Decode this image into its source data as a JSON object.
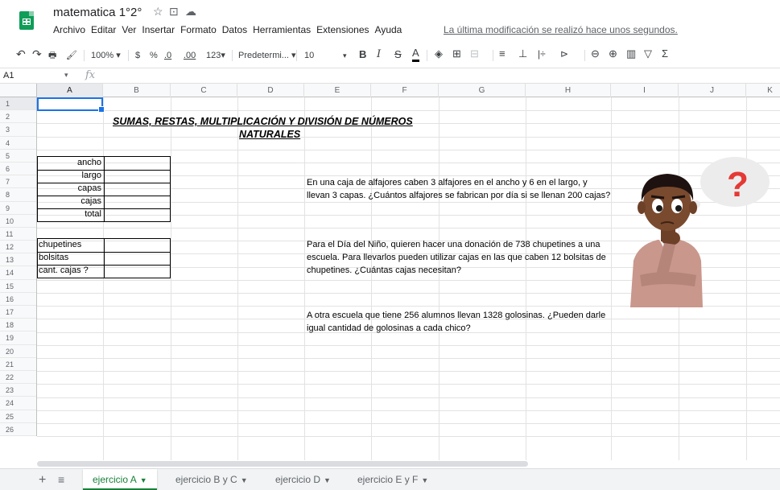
{
  "app": {
    "doc_title": "matematica 1°2°",
    "icons": [
      "star-icon",
      "move-to-folder-icon",
      "cloud-status-icon"
    ],
    "star_glyph": "☆",
    "folder_glyph": "⊡",
    "cloud_glyph": "☁",
    "brand_color": "#0f9d58"
  },
  "menu": {
    "items": [
      "Archivo",
      "Editar",
      "Ver",
      "Insertar",
      "Formato",
      "Datos",
      "Herramientas",
      "Extensiones",
      "Ayuda"
    ],
    "last_edit": "La última modificación se realizó hace unos segundos."
  },
  "toolbar": {
    "undo": "↶",
    "redo": "↷",
    "print": "🖶",
    "paint_format": "🖌",
    "zoom": "100%",
    "currency": "$",
    "percent": "%",
    "dec_decrease": ".0",
    "dec_increase": ".00",
    "more_formats": "123",
    "font": "Predetermi...",
    "font_size": "10",
    "bold": "B",
    "italic": "I",
    "strike": "S",
    "text_color": "A",
    "fill": "◈",
    "borders": "⊞",
    "merge": "⊟",
    "align_h": "≡",
    "align_v": "⊥",
    "wrap": "|÷",
    "rotate": "⊳",
    "link": "⊖",
    "comment": "⊕",
    "chart": "▥",
    "filter": "▽",
    "functions": "Σ"
  },
  "formula_bar": {
    "cell_ref": "A1",
    "fx": "fx",
    "value": ""
  },
  "columns": [
    "A",
    "B",
    "C",
    "D",
    "E",
    "F",
    "G",
    "H",
    "I",
    "J",
    "K"
  ],
  "rows": [
    "1",
    "2",
    "3",
    "4",
    "5",
    "6",
    "7",
    "8",
    "9",
    "10",
    "11",
    "12",
    "13",
    "14",
    "15",
    "16",
    "17",
    "18",
    "19",
    "20",
    "21",
    "22",
    "23",
    "24",
    "25",
    "26"
  ],
  "sheet": {
    "heading_line1": "SUMAS, RESTAS, MULTIPLICACIÓN Y DIVISIÓN DE NÚMEROS",
    "heading_line2": "NATURALES",
    "table1": [
      "ancho",
      "largo",
      "capas",
      "cajas",
      "total"
    ],
    "table2": [
      "chupetines",
      "bolsitas",
      "cant. cajas ?"
    ],
    "problem1": [
      "En una caja de alfajores caben 3 alfajores en el ancho y 6 en el largo, y",
      "llevan 3 capas. ¿Cuántos alfajores se fabrican por día si se llenan 200 cajas?"
    ],
    "problem2": [
      "Para el Día del Niño, quieren hacer una donación de 738 chupetines a una",
      "escuela. Para llevarlos pueden utilizar cajas en las que caben 12 bolsitas de",
      "chupetines. ¿Cuántas cajas necesitan?"
    ],
    "problem3": [
      "A otra escuela que tiene 256 alumnos llevan 1328 golosinas. ¿Pueden darle",
      "igual cantidad de golosinas a cada chico?"
    ],
    "thought_mark": "?"
  },
  "tabs": {
    "add": "+",
    "all_sheets": "≡",
    "items": [
      "ejercicio A",
      "ejercicio B y C",
      "ejercicio D",
      "ejercicio E y F"
    ],
    "active_index": 0,
    "active_color": "#188038"
  }
}
